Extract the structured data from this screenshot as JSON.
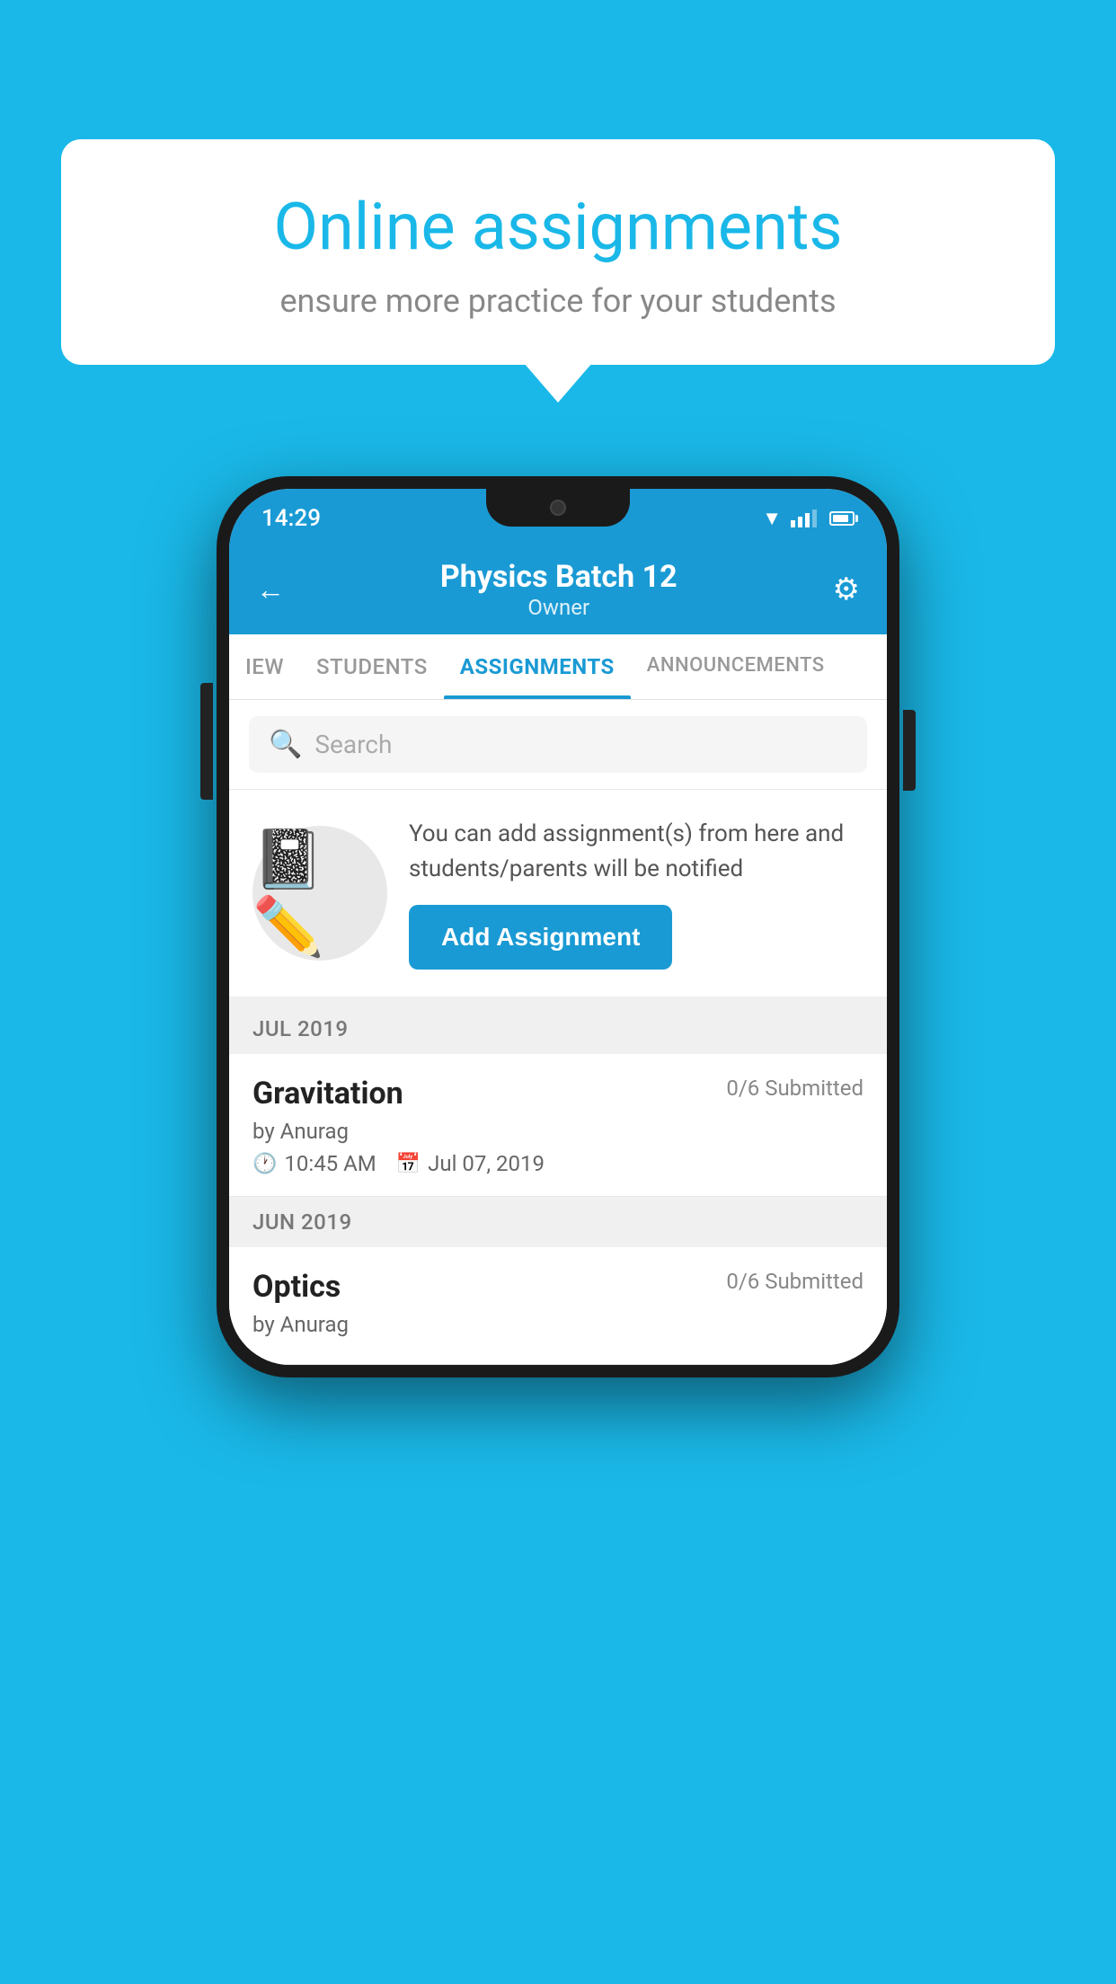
{
  "background_color": "#1ab8e8",
  "bubble": {
    "title": "Online assignments",
    "subtitle": "ensure more practice for your students"
  },
  "phone": {
    "status_bar": {
      "time": "14:29"
    },
    "header": {
      "title": "Physics Batch 12",
      "subtitle": "Owner",
      "back_label": "←",
      "settings_label": "⚙"
    },
    "tabs": [
      {
        "label": "IEW",
        "active": false
      },
      {
        "label": "STUDENTS",
        "active": false
      },
      {
        "label": "ASSIGNMENTS",
        "active": true
      },
      {
        "label": "ANNOUNCEMENTS",
        "active": false
      }
    ],
    "search": {
      "placeholder": "Search"
    },
    "promo": {
      "text": "You can add assignment(s) from here and students/parents will be notified",
      "button_label": "Add Assignment"
    },
    "sections": [
      {
        "label": "JUL 2019",
        "assignments": [
          {
            "title": "Gravitation",
            "submitted": "0/6 Submitted",
            "by": "by Anurag",
            "time": "10:45 AM",
            "date": "Jul 07, 2019"
          }
        ]
      },
      {
        "label": "JUN 2019",
        "assignments": [
          {
            "title": "Optics",
            "submitted": "0/6 Submitted",
            "by": "by Anurag",
            "time": "",
            "date": ""
          }
        ]
      }
    ]
  }
}
